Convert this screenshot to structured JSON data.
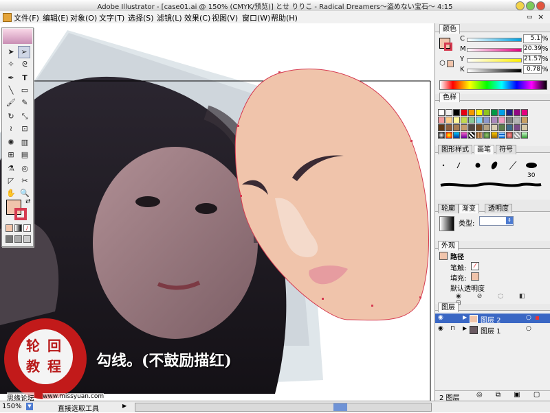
{
  "window": {
    "title": "Adobe Illustrator - [case01.ai @ 150% (CMYK/预览)] とせ  りりこ - Radical Dreamers～盗めない宝石～  4:15"
  },
  "menu": [
    "文件(F)",
    "编辑(E)",
    "对象(O)",
    "文字(T)",
    "选择(S)",
    "滤镜(L)",
    "效果(C)",
    "视图(V)",
    "窗口(W)",
    "帮助(H)"
  ],
  "caption": "勾线。(不鼓励描红)",
  "watermark": {
    "line1": "轮 回",
    "line2": "教 程",
    "site_cn": "思缘论坛",
    "site_url": "www.missyuan.com"
  },
  "status": {
    "zoom": "150%",
    "tool": "直接选取工具"
  },
  "panels": {
    "color": {
      "tab": "颜色",
      "channels": [
        {
          "label": "C",
          "value": "5.1",
          "unit": "%"
        },
        {
          "label": "M",
          "value": "20.39",
          "unit": "%"
        },
        {
          "label": "Y",
          "value": "21.57",
          "unit": "%"
        },
        {
          "label": "K",
          "value": "0.78",
          "unit": "%"
        }
      ]
    },
    "swatches": {
      "tab": "色样"
    },
    "brushes": {
      "tabs": [
        "图形样式",
        "画笔",
        "符号"
      ],
      "size_label": "30"
    },
    "gradient": {
      "tabs": [
        "轮廓",
        "渐变",
        "透明度"
      ],
      "type_label": "类型:"
    },
    "appearance": {
      "tab": "外观",
      "title": "路径",
      "stroke_label": "笔触:",
      "fill_label": "填充:",
      "opacity_label": "默认透明度"
    },
    "layers": {
      "tab": "图层",
      "items": [
        {
          "name": "图层 2"
        },
        {
          "name": "图层 1"
        }
      ],
      "count": "2 图层"
    }
  },
  "colors": {
    "fill": "#f0c4ab",
    "outline": "#d63a50",
    "chrome": "#efefef",
    "brow": "#3a2a33",
    "lips": "#e69ca0"
  }
}
